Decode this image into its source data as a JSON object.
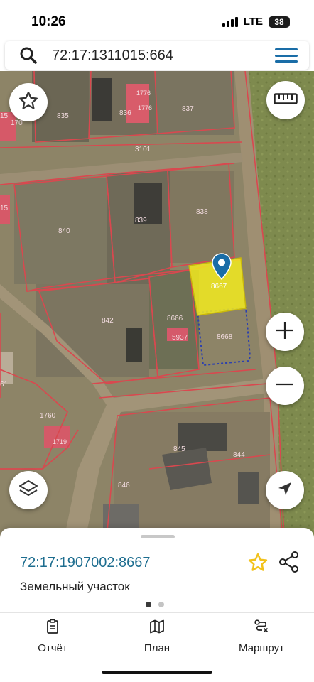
{
  "status": {
    "time": "10:26",
    "network": "LTE",
    "battery": "38"
  },
  "search": {
    "query": "72:17:1311015:664"
  },
  "map": {
    "parcel_labels": [
      "835",
      "836",
      "837",
      "1776",
      "1776",
      "170",
      "3101",
      "839",
      "838",
      "840",
      "8667",
      "842",
      "8666",
      "5937",
      "8668",
      "1760",
      "1719",
      "845",
      "844",
      "846",
      "61",
      "15",
      "15"
    ]
  },
  "sheet": {
    "cadastral_number": "72:17:1907002:8667",
    "object_type": "Земельный участок"
  },
  "tabs": [
    {
      "label": "Отчёт",
      "icon": "report-icon"
    },
    {
      "label": "План",
      "icon": "map-icon"
    },
    {
      "label": "Маршрут",
      "icon": "route-icon"
    }
  ],
  "colors": {
    "accent": "#1a6da7",
    "parcel_highlight": "#f2ea1e",
    "star": "#f2c21b",
    "boundary": "#d9484f"
  }
}
